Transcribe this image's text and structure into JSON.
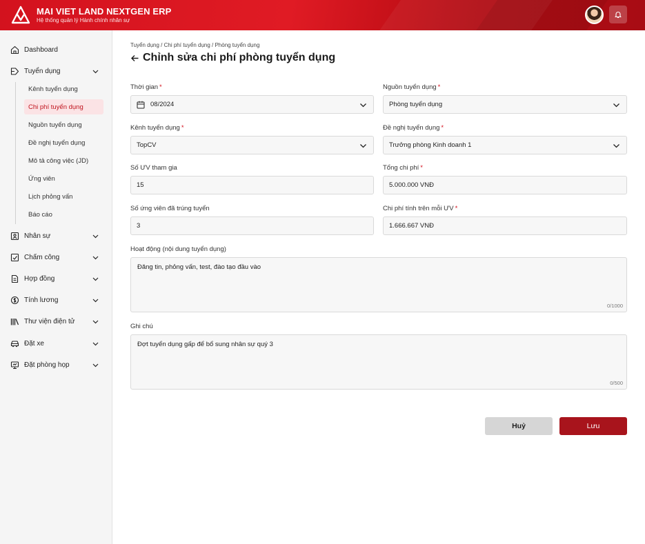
{
  "header": {
    "title": "MAI VIET LAND NEXTGEN ERP",
    "subtitle": "Hệ thống quản lý Hành chính nhân sự"
  },
  "sidebar": {
    "items": [
      {
        "label": "Dashboard",
        "icon": "home-icon"
      },
      {
        "label": "Tuyển dụng",
        "icon": "recruitment-icon"
      },
      {
        "label": "Nhân sự",
        "icon": "person-card-icon"
      },
      {
        "label": "Chấm công",
        "icon": "timesheet-icon"
      },
      {
        "label": "Hợp đồng",
        "icon": "contract-icon"
      },
      {
        "label": "Tính lương",
        "icon": "dollar-icon"
      },
      {
        "label": "Thư viện điện tử",
        "icon": "library-icon"
      },
      {
        "label": "Đặt xe",
        "icon": "car-icon"
      },
      {
        "label": "Đặt phòng họp",
        "icon": "meeting-icon"
      }
    ],
    "sub_items": [
      {
        "label": "Kênh tuyển dụng"
      },
      {
        "label": "Chi phí tuyển dụng"
      },
      {
        "label": "Nguồn tuyển dụng"
      },
      {
        "label": "Đề nghị tuyển dụng"
      },
      {
        "label": "Mô tả công việc (JD)"
      },
      {
        "label": "Ứng viên"
      },
      {
        "label": "Lịch phỏng vấn"
      },
      {
        "label": "Báo cáo"
      }
    ]
  },
  "main": {
    "breadcrumb": "Tuyển dụng / Chi phí tuyển dụng / Phòng tuyển dụng",
    "title": "Chỉnh sửa chi phí phòng tuyển dụng",
    "fields": {
      "time": {
        "label": "Thời gian",
        "value": "08/2024"
      },
      "source": {
        "label": "Nguồn tuyển dụng",
        "value": "Phòng tuyển dụng"
      },
      "channel": {
        "label": "Kênh tuyển dụng",
        "value": "TopCV"
      },
      "request": {
        "label": "Đề nghị tuyển dụng",
        "value": "Trưởng phòng Kinh doanh 1"
      },
      "candidates": {
        "label": "Số ƯV tham gia",
        "value": "15"
      },
      "total_cost": {
        "label": "Tổng chi phí",
        "value": "5.000.000 VNĐ"
      },
      "hired": {
        "label": "Số ứng viên đã trúng tuyển",
        "value": "3"
      },
      "cost_per": {
        "label": "Chi phí tính trên mỗi ƯV",
        "value": "1.666.667 VNĐ"
      },
      "activity": {
        "label": "Hoạt động (nội dung tuyển dụng)",
        "value": "Đăng tin, phỏng vấn, test, đào tạo đầu vào",
        "counter": "0/1000"
      },
      "note": {
        "label": "Ghi chú",
        "value": "Đợt tuyển dụng gấp để bổ sung nhân sự quý 3",
        "counter": "0/500"
      }
    },
    "required_mark": "*",
    "buttons": {
      "cancel": "Huỷ",
      "save": "Lưu"
    }
  },
  "colors": {
    "brand": "#d3121e",
    "save": "#a8141c",
    "active_bg": "#fbe3e5"
  }
}
